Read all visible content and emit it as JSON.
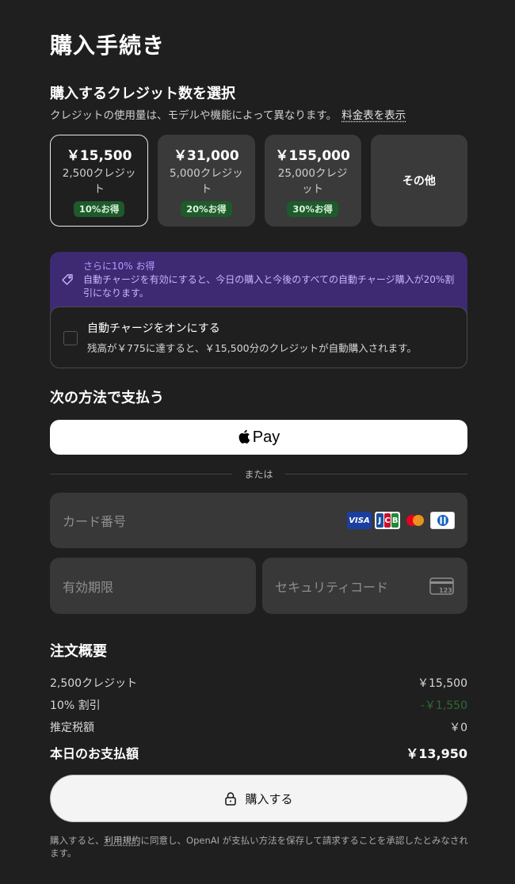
{
  "page": {
    "title": "購入手続き"
  },
  "credits_section": {
    "title": "購入するクレジット数を選択",
    "description": "クレジットの使用量は、モデルや機能によって異なります。",
    "pricing_link": "料金表を表示",
    "options": [
      {
        "price": "￥15,500",
        "credits": "2,500クレジット",
        "badge": "10%お得",
        "selected": true
      },
      {
        "price": "￥31,000",
        "credits": "5,000クレジット",
        "badge": "20%お得",
        "selected": false
      },
      {
        "price": "￥155,000",
        "credits": "25,000クレジット",
        "badge": "30%お得",
        "selected": false
      }
    ],
    "other_label": "その他"
  },
  "promo": {
    "title": "さらに10% お得",
    "text": "自動チャージを有効にすると、今日の購入と今後のすべての自動チャージ購入が20%割引になります。",
    "auto_charge": {
      "label": "自動チャージをオンにする",
      "description": "残高が￥775に達すると、￥15,500分のクレジットが自動購入されます。",
      "checked": false
    }
  },
  "payment": {
    "title": "次の方法で支払う",
    "apple_pay_label": "Pay",
    "divider": "または",
    "card_number_placeholder": "カード番号",
    "expiry_placeholder": "有効期限",
    "security_code_placeholder": "セキュリティコード",
    "brands": {
      "visa": "VISA",
      "jcb": [
        "J",
        "C",
        "B"
      ],
      "cvc": "123"
    }
  },
  "summary": {
    "title": "注文概要",
    "rows": [
      {
        "label": "2,500クレジット",
        "value": "￥15,500"
      },
      {
        "label": "10% 割引",
        "value": "-￥1,550"
      },
      {
        "label": "推定税額",
        "value": "￥0"
      }
    ],
    "total_label": "本日のお支払額",
    "total_value": "￥13,950"
  },
  "buy_button": "購入する",
  "legal": {
    "prefix": "購入すると、",
    "terms": "利用規約",
    "suffix": "に同意し、OpenAI が支払い方法を保存して請求することを承認したとみなされます。"
  },
  "colors": {
    "background": "#1f1f1f",
    "card": "#3a3a3a",
    "badge": "#1e5a2a",
    "promo": "#3d2a73",
    "discount": "#2e6b33"
  }
}
